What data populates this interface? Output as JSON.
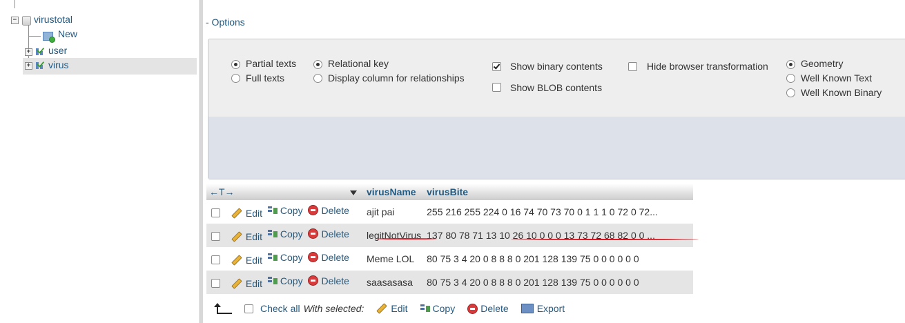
{
  "nav": {
    "database": "virustotal",
    "new_label": "New",
    "tables": [
      "user",
      "virus"
    ],
    "selected_table": "virus"
  },
  "options": {
    "toggle_label": "- Options",
    "partial_texts": "Partial texts",
    "full_texts": "Full texts",
    "relational_key": "Relational key",
    "display_column": "Display column for relationships",
    "show_binary": "Show binary contents",
    "show_blob": "Show BLOB contents",
    "hide_transformation": "Hide browser transformation",
    "geometry": "Geometry",
    "wkt": "Well Known Text",
    "wkb": "Well Known Binary"
  },
  "table": {
    "column_arrows": "←T→",
    "columns": [
      "virusName",
      "virusBite"
    ],
    "actions": {
      "edit": "Edit",
      "copy": "Copy",
      "delete": "Delete"
    },
    "rows": [
      {
        "name": "ajit pai",
        "bite": "255 216 255 224 0 16 74 70 73 70 0 1 1 1 0 72 0 72..."
      },
      {
        "name": "legitNotVirus",
        "bite": "137 80 78 71 13 10 26 10 0 0 0 13 73 72 68 82 0 0 ..."
      },
      {
        "name": "Meme LOL",
        "bite": "80 75 3 4 20 0 8 8 8 0 201 128 139 75 0 0 0 0 0 0"
      },
      {
        "name": "saasasasa",
        "bite": "80 75 3 4 20 0 8 8 8 0 201 128 139 75 0 0 0 0 0 0"
      }
    ]
  },
  "bottom": {
    "check_all": "Check all",
    "with_selected": "With selected:",
    "edit": "Edit",
    "copy": "Copy",
    "delete": "Delete",
    "export": "Export"
  },
  "colors": {
    "link": "#235a81",
    "annotation": "#e0141e"
  }
}
